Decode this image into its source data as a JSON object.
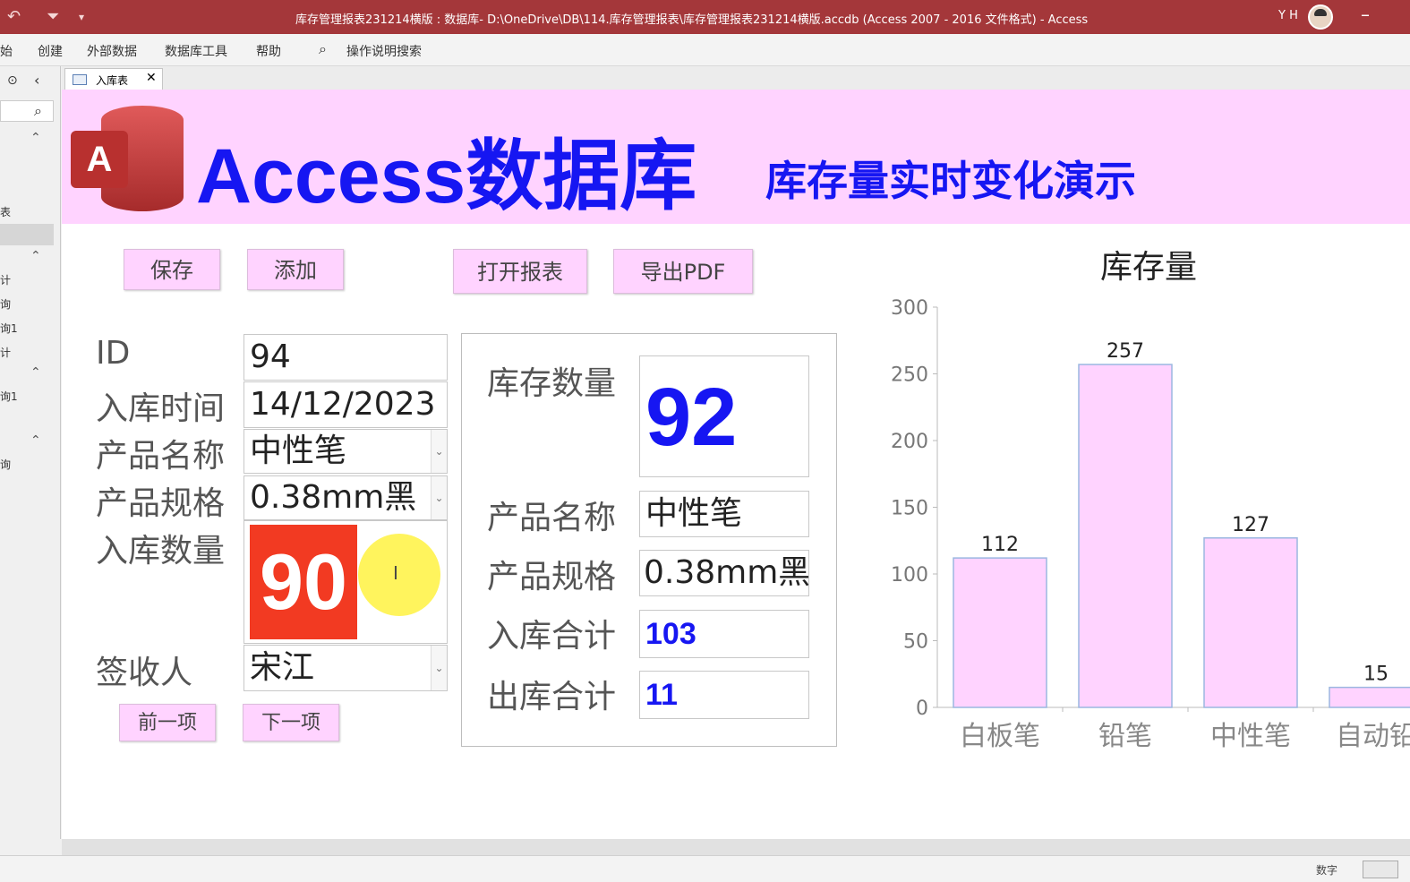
{
  "titlebar": {
    "title": "库存管理报表231214横版 : 数据库- D:\\OneDrive\\DB\\114.库存管理报表\\库存管理报表231214横版.accdb (Access 2007 - 2016 文件格式)  -  Access",
    "user": "Y H",
    "minimize": "–"
  },
  "menu": {
    "items": [
      "始",
      "创建",
      "外部数据",
      "数据库工具",
      "帮助"
    ],
    "search_label": "操作说明搜索"
  },
  "nav": {
    "items": [
      "表",
      "计",
      "询",
      "询1",
      "计",
      "询1",
      "询"
    ]
  },
  "tab": {
    "label": "入库表",
    "close": "✕"
  },
  "banner": {
    "logo_letter": "A",
    "title": "Access数据库",
    "subtitle": "库存量实时变化演示"
  },
  "buttons": {
    "save": "保存",
    "add": "添加",
    "open_report": "打开报表",
    "export_pdf": "导出PDF",
    "prev": "前一项",
    "next": "下一项"
  },
  "form": {
    "labels": {
      "id": "ID",
      "in_time": "入库时间",
      "product_name": "产品名称",
      "product_spec": "产品规格",
      "in_qty": "入库数量",
      "receiver": "签收人"
    },
    "values": {
      "id": "94",
      "in_time": "14/12/2023",
      "product_name": "中性笔",
      "product_spec": "0.38mm黑",
      "in_qty": "90",
      "receiver": "宋江"
    },
    "cursor_glyph": "I"
  },
  "stock_panel": {
    "labels": {
      "stock_qty": "库存数量",
      "product_name": "产品名称",
      "product_spec": "产品规格",
      "in_total": "入库合计",
      "out_total": "出库合计"
    },
    "values": {
      "stock_qty": "92",
      "product_name": "中性笔",
      "product_spec": "0.38mm黑",
      "in_total": "103",
      "out_total": "11"
    }
  },
  "chart_data": {
    "type": "bar",
    "title": "库存量",
    "categories": [
      "白板笔",
      "铅笔",
      "中性笔",
      "自动铅"
    ],
    "values": [
      112,
      257,
      127,
      15
    ],
    "ylim": [
      0,
      300
    ],
    "yticks": [
      0,
      50,
      100,
      150,
      200,
      250,
      300
    ],
    "bar_color": "#ffd3ff",
    "bar_edge": "#9bb7e0",
    "grid": false
  },
  "status": {
    "mode": "数字"
  },
  "colors": {
    "titlebar": "#a4373a",
    "banner": "#ffd3ff",
    "title_blue": "#1616f2",
    "highlight_red": "#f23a22",
    "cursor_yellow": "#fff34c"
  }
}
